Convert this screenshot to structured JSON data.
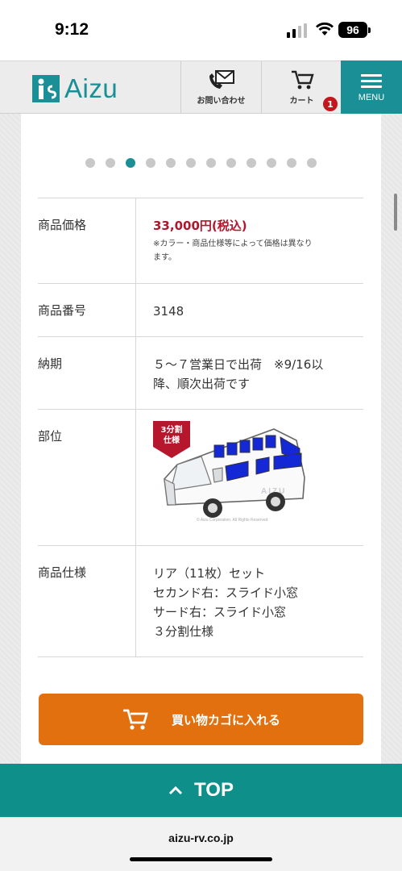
{
  "status_bar": {
    "time": "9:12",
    "battery": "96"
  },
  "header": {
    "logo_text": "Aizu",
    "contact_label": "お問い合わせ",
    "cart_label": "カート",
    "cart_badge": "1",
    "menu_label": "MENU"
  },
  "carousel": {
    "total_dots": 12,
    "active_index": 2
  },
  "spec": {
    "price_label": "商品価格",
    "price_value": "33,000円(税込)",
    "price_note_line1": "※カラー・商品仕様等によって価格は異なり",
    "price_note_line2": "ます。",
    "number_label": "商品番号",
    "number_value": "3148",
    "delivery_label": "納期",
    "delivery_line1": "５～７営業日で出荷　※9/16以",
    "delivery_line2": "降、順次出荷です",
    "part_label": "部位",
    "part_badge_line1": "3分割",
    "part_badge_line2": "仕様",
    "part_van_brand": "AIZU",
    "part_copyright": "© Aizu Corporation. All Rights Reserved",
    "spec_label": "商品仕様",
    "spec_lines": [
      "リア（11枚）セット",
      "セカンド右：スライド小窓",
      "サード右：スライド小窓",
      "３分割仕様"
    ]
  },
  "add_to_cart_label": "買い物カゴに入れる",
  "top_label": "TOP",
  "url": "aizu-rv.co.jp",
  "colors": {
    "brand_teal": "#1a8f96",
    "price_red": "#b1172c",
    "cart_orange": "#e2700e",
    "badge_red": "#c4161c"
  }
}
